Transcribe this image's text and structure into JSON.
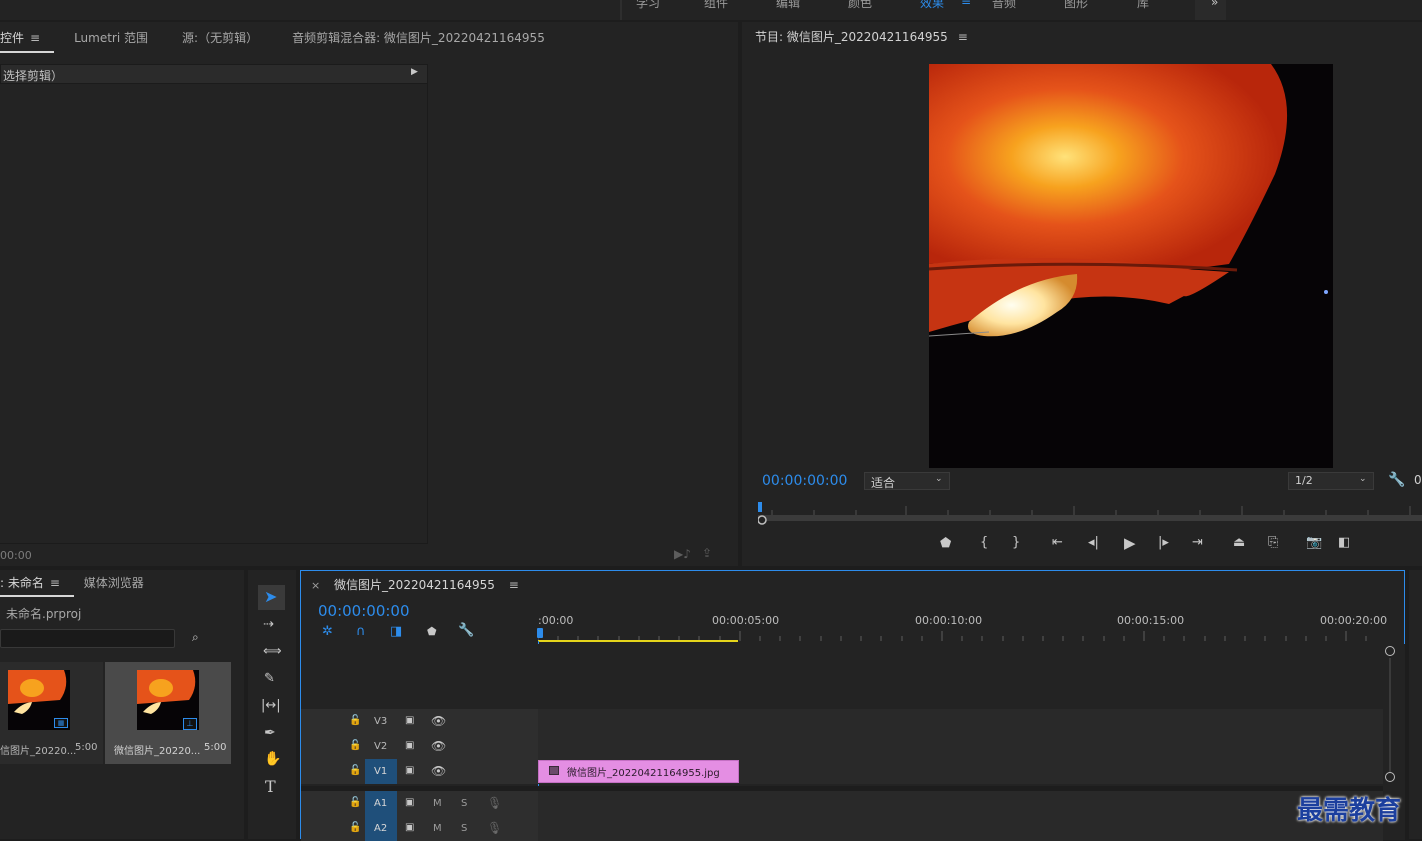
{
  "workspace_tabs": {
    "items": [
      "学习",
      "组件",
      "编辑",
      "颜色",
      "效果",
      "音频",
      "图形",
      "库"
    ],
    "active_index": 4,
    "overflow": "»",
    "menu": "≡"
  },
  "source_panel": {
    "tabs": [
      "效果控件",
      "Lumetri 范围",
      "源:（无剪辑）",
      "音频剪辑混合器: 微信图片_20220421164955"
    ],
    "active_tab_label": "控件",
    "no_clip_label": "（未选择剪辑）",
    "no_clip_visible": "选择剪辑）",
    "timecode": "00:00"
  },
  "program_monitor": {
    "title": "节目: 微信图片_20220421164955",
    "timecode": "00:00:00:00",
    "fit_label": "适合",
    "resolution": "1/2",
    "end_glyph": "0"
  },
  "project_panel": {
    "tab_project": "项目: 未命名",
    "tab_project_visible": ": 未命名",
    "tab_media": "媒体浏览器",
    "project_file": "未命名.prproj",
    "items": [
      {
        "name": "信图片_20220...",
        "duration": "5:00"
      },
      {
        "name": "微信图片_20220...",
        "duration": "5:00"
      }
    ]
  },
  "timeline": {
    "sequence_name": "微信图片_20220421164955",
    "close": "×",
    "timecode": "00:00:00:00",
    "ruler": [
      ":00:00",
      "00:00:05:00",
      "00:00:10:00",
      "00:00:15:00",
      "00:00:20:00"
    ],
    "video_tracks": [
      "V3",
      "V2",
      "V1"
    ],
    "audio_tracks": [
      "A1",
      "A2"
    ],
    "mute": "M",
    "solo": "S",
    "clip_name": "微信图片_20220421164955.jpg",
    "clip_color": "#e48ee3"
  },
  "watermark": "最需教育",
  "colors": {
    "accent": "#2d8ceb",
    "panel": "#232323",
    "playhead": "#2d8ceb",
    "workarea": "#e5d51b"
  }
}
